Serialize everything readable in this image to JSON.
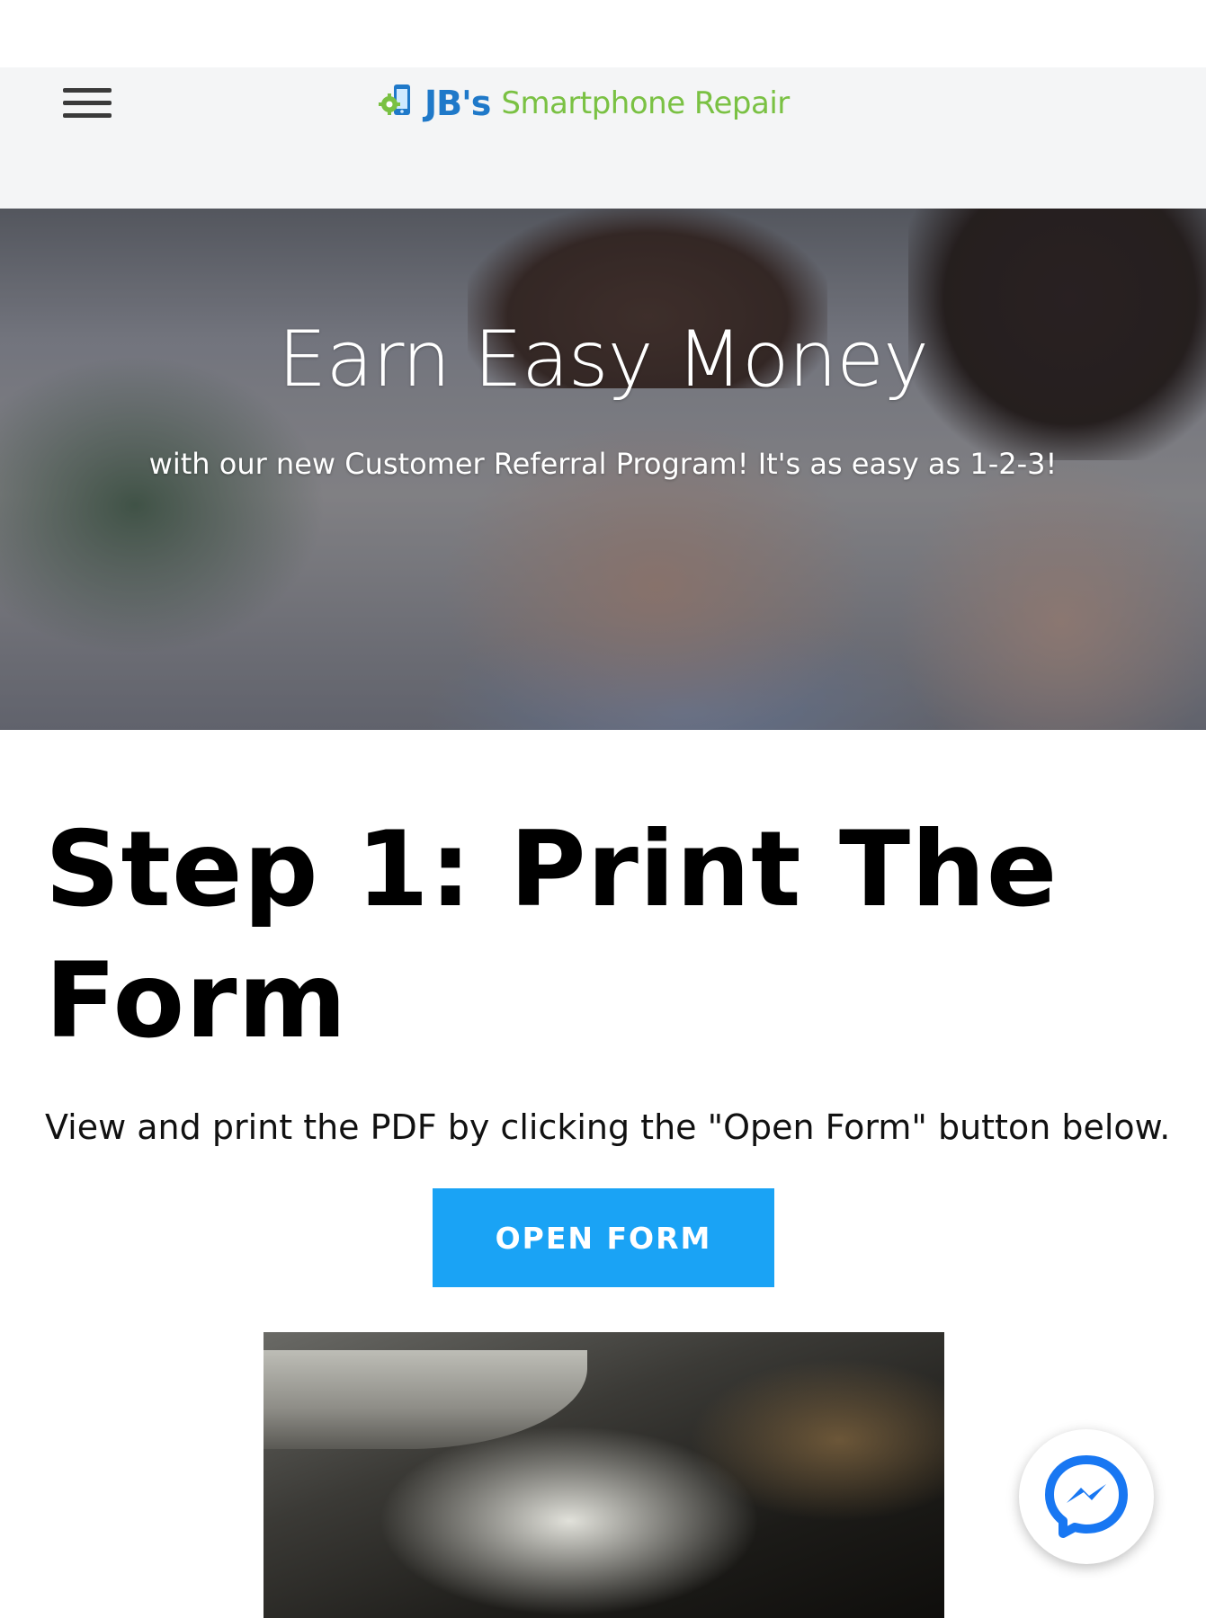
{
  "header": {
    "menu_icon": "hamburger-menu-icon",
    "logo_mark_icon": "phone-gear-icon",
    "logo_brand": "JB's",
    "logo_name": "Smartphone Repair",
    "colors": {
      "brand_blue": "#1f79c9",
      "brand_green": "#7ac143"
    }
  },
  "hero": {
    "title": "Earn Easy Money",
    "subtitle": "with our new Customer Referral Program! It's as easy as 1-2-3!"
  },
  "step1": {
    "title_line1": "Step 1: Print The",
    "title_line2": "Form",
    "description": "View and print the PDF by clicking the \"Open Form\" button below.",
    "button_label": "OPEN FORM",
    "button_color": "#1aa3f5"
  },
  "chat": {
    "icon": "messenger-icon",
    "color": "#1877f2"
  }
}
